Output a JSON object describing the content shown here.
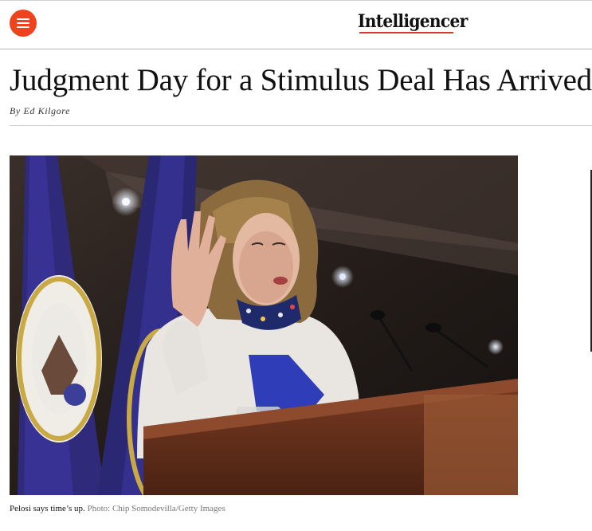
{
  "header": {
    "menu_icon": "hamburger-menu-icon",
    "logo": "Intelligencer",
    "accent_color": "#f0421f"
  },
  "article": {
    "headline": "Judgment Day for a Stimulus Deal Has Arrived",
    "byline": "By Ed Kilgore",
    "image": {
      "caption": "Pelosi says time’s up.",
      "credit": "Photo: Chip Somodevilla/Getty Images"
    }
  }
}
